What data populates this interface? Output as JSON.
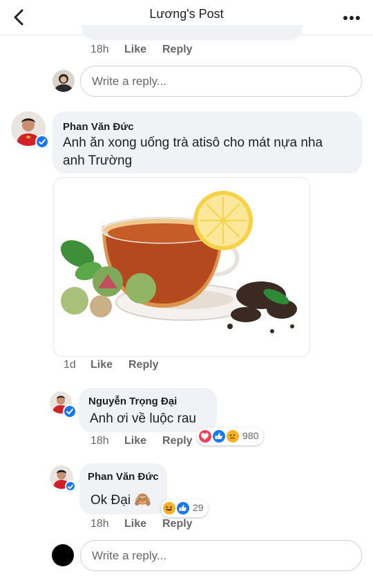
{
  "header": {
    "title": "Lương's Post"
  },
  "top_meta": {
    "time": "18h",
    "like": "Like",
    "reply": "Reply"
  },
  "reply_input_top": {
    "placeholder": "Write a reply..."
  },
  "comment_main": {
    "author": "Phan Văn Đức",
    "text_line1": "Anh ăn xong uống trà atisô cho mát nựa nha",
    "text_line2": "anh Trường",
    "time": "1d",
    "like": "Like",
    "reply": "Reply"
  },
  "reply1": {
    "author": "Nguyễn Trọng Đại",
    "text": "Anh ơi về luộc rau",
    "time": "18h",
    "like": "Like",
    "reply": "Reply",
    "reactions": {
      "icons": [
        "love",
        "like",
        "sad"
      ],
      "count": "980"
    }
  },
  "reply2": {
    "author": "Phan Văn Đức",
    "text": "Ok Đại",
    "emoji": "🙈",
    "time": "18h",
    "like": "Like",
    "reply": "Reply",
    "reactions": {
      "icons": [
        "haha",
        "like"
      ],
      "count": "29"
    }
  },
  "reply_input_bottom": {
    "placeholder": "Write a reply..."
  },
  "colors": {
    "accent": "#1877f2",
    "bubble": "#f0f2f5",
    "meta": "#65676b",
    "love": "#f33e58",
    "haha": "#f7b125"
  }
}
